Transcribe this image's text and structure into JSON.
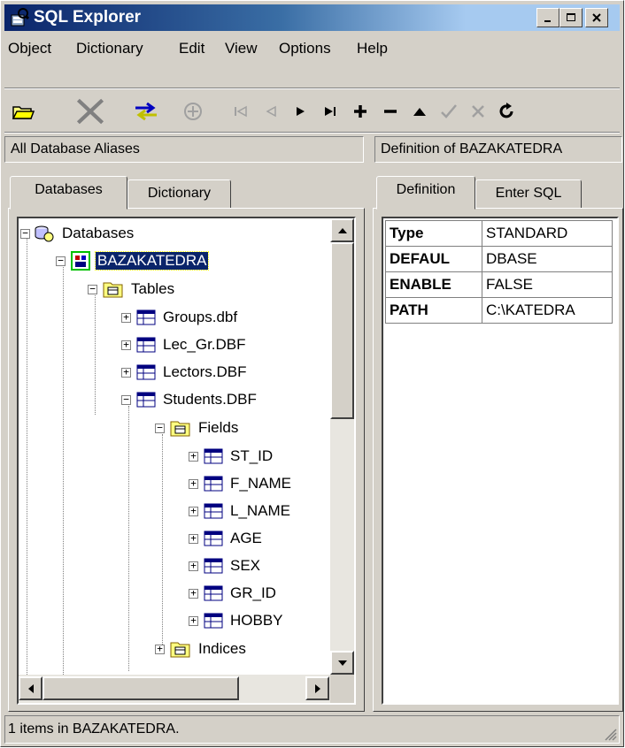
{
  "window": {
    "title": "SQL Explorer"
  },
  "menu": [
    "Object",
    "Dictionary",
    "Edit",
    "View",
    "Options",
    "Help"
  ],
  "toolbar": {
    "buttons": [
      "open-folder",
      "delete",
      "refresh-swap",
      "apply-disabled",
      "first",
      "prior",
      "next",
      "last",
      "insert",
      "delete-record",
      "edit",
      "post",
      "cancel",
      "refresh"
    ]
  },
  "left_header": "All Database Aliases",
  "right_header": "Definition of BAZAKATEDRA",
  "left_tabs": [
    "Databases",
    "Dictionary"
  ],
  "right_tabs": [
    "Definition",
    "Enter SQL"
  ],
  "tree": {
    "root": "Databases",
    "db": "BAZAKATEDRA",
    "tables": "Tables",
    "table_items": [
      "Groups.dbf",
      "Lec_Gr.DBF",
      "Lectors.DBF",
      "Students.DBF"
    ],
    "fields": "Fields",
    "field_items": [
      "ST_ID",
      "F_NAME",
      "L_NAME",
      "AGE",
      "SEX",
      "GR_ID",
      "HOBBY"
    ],
    "indices": "Indices"
  },
  "definition": [
    {
      "key": "Type",
      "value": "STANDARD"
    },
    {
      "key": "DEFAUL",
      "value": "DBASE"
    },
    {
      "key": "ENABLE",
      "value": "FALSE"
    },
    {
      "key": "PATH",
      "value": "C:\\KATEDRA"
    }
  ],
  "status": "1 items in BAZAKATEDRA."
}
